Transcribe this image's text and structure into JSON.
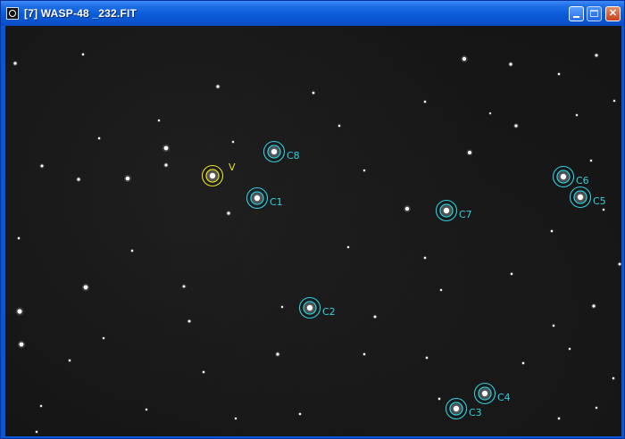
{
  "window": {
    "title": "[7] WASP-48 _232.FIT",
    "buttons": {
      "minimize": "minimize-icon",
      "maximize": "maximize-icon",
      "close": "close-icon"
    }
  },
  "colors": {
    "target_marker": "#e8e020",
    "comparison_marker": "#30d0e0",
    "background": "#151515"
  },
  "markers": [
    {
      "label": "V",
      "kind": "target"
    },
    {
      "label": "C8",
      "kind": "comparison"
    },
    {
      "label": "C1",
      "kind": "comparison"
    },
    {
      "label": "C7",
      "kind": "comparison"
    },
    {
      "label": "C6",
      "kind": "comparison"
    },
    {
      "label": "C5",
      "kind": "comparison"
    },
    {
      "label": "C2",
      "kind": "comparison"
    },
    {
      "label": "C4",
      "kind": "comparison"
    },
    {
      "label": "C3",
      "kind": "comparison"
    }
  ]
}
